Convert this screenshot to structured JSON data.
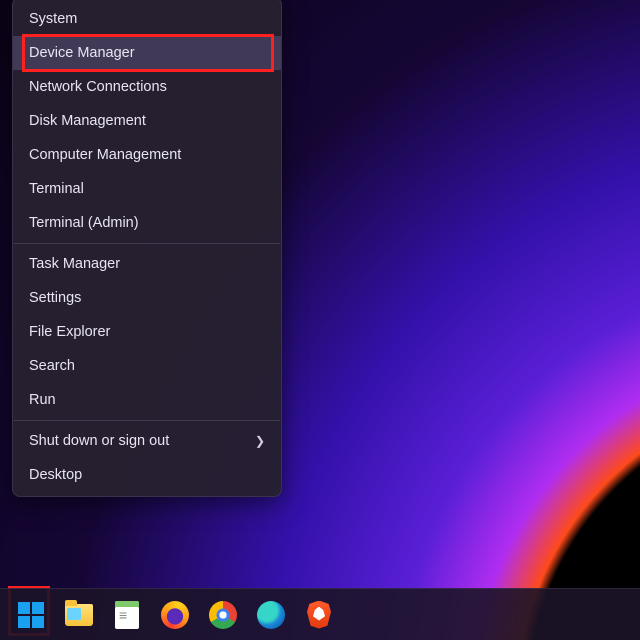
{
  "menu": {
    "groups": [
      {
        "items": [
          {
            "label": "System",
            "name": "menu-item-system"
          },
          {
            "label": "Device Manager",
            "name": "menu-item-device-manager",
            "hover": true
          },
          {
            "label": "Network Connections",
            "name": "menu-item-network-connections"
          },
          {
            "label": "Disk Management",
            "name": "menu-item-disk-management"
          },
          {
            "label": "Computer Management",
            "name": "menu-item-computer-management"
          },
          {
            "label": "Terminal",
            "name": "menu-item-terminal"
          },
          {
            "label": "Terminal (Admin)",
            "name": "menu-item-terminal-admin"
          }
        ]
      },
      {
        "items": [
          {
            "label": "Task Manager",
            "name": "menu-item-task-manager"
          },
          {
            "label": "Settings",
            "name": "menu-item-settings"
          },
          {
            "label": "File Explorer",
            "name": "menu-item-file-explorer"
          },
          {
            "label": "Search",
            "name": "menu-item-search"
          },
          {
            "label": "Run",
            "name": "menu-item-run"
          }
        ]
      },
      {
        "items": [
          {
            "label": "Shut down or sign out",
            "name": "menu-item-shutdown",
            "submenu": true
          },
          {
            "label": "Desktop",
            "name": "menu-item-desktop"
          }
        ]
      }
    ]
  },
  "taskbar": {
    "items": [
      {
        "name": "start-button",
        "icon": "start-icon"
      },
      {
        "name": "file-explorer-button",
        "icon": "folder-icon"
      },
      {
        "name": "notepadpp-button",
        "icon": "notepad-icon"
      },
      {
        "name": "firefox-button",
        "icon": "firefox-icon"
      },
      {
        "name": "chrome-button",
        "icon": "chrome-icon"
      },
      {
        "name": "edge-button",
        "icon": "edge-icon"
      },
      {
        "name": "brave-button",
        "icon": "brave-icon"
      }
    ]
  },
  "annotations": {
    "highlight_device_manager": true,
    "highlight_start_button": true
  }
}
